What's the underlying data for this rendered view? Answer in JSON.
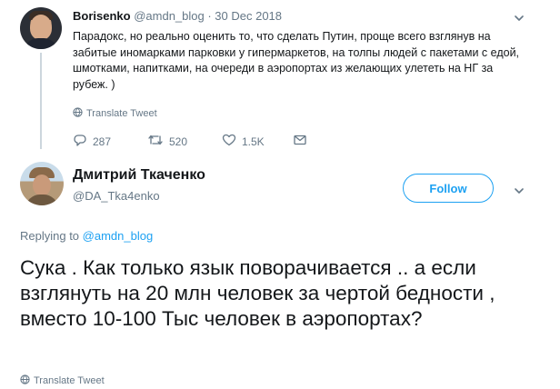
{
  "parent_tweet": {
    "name": "Borisenko",
    "handle": "@amdn_blog",
    "separator": " · ",
    "date": "30 Dec 2018",
    "text": "Парадокс, но реально оценить то, что сделать Путин, проще всего взглянув на забитые иномарками парковки у гипермаркетов, на толпы людей с пакетами с едой, шмотками, напитками, на очереди в аэропортах из желающих улететь на НГ за рубеж. )",
    "translate_label": "Translate Tweet",
    "replies": "287",
    "retweets": "520",
    "likes": "1.5K"
  },
  "reply_tweet": {
    "name": "Дмитрий Ткаченко",
    "handle": "@DA_Tka4enko",
    "follow_label": "Follow",
    "replying_prefix": "Replying to ",
    "replying_to": "@amdn_blog",
    "text": "Сука . Как только язык поворачивается .. а если взглянуть на 20 млн человек за чертой бедности , вместо 10-100 Тыс человек в аэропортах?",
    "translate_label": "Translate Tweet"
  },
  "colors": {
    "accent": "#1da1f2",
    "muted": "#657786",
    "text": "#14171a",
    "thread_line": "#ccd6dd"
  },
  "icons": [
    "reply-icon",
    "retweet-icon",
    "like-icon",
    "dm-icon",
    "globe-icon",
    "chevron-down-icon"
  ]
}
